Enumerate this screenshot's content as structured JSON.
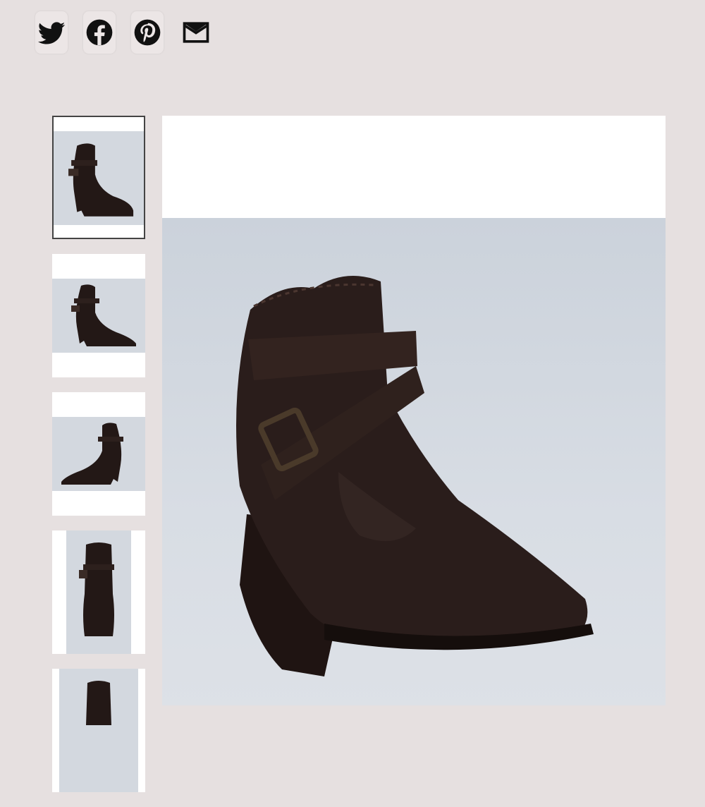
{
  "share": {
    "items": [
      {
        "name": "twitter",
        "icon": "twitter-icon"
      },
      {
        "name": "facebook",
        "icon": "facebook-icon"
      },
      {
        "name": "pinterest",
        "icon": "pinterest-icon"
      },
      {
        "name": "email",
        "icon": "mail-icon"
      }
    ]
  },
  "gallery": {
    "thumbnails": [
      {
        "view": "side-left",
        "active": true
      },
      {
        "view": "side-left-2",
        "active": false
      },
      {
        "view": "side-right",
        "active": false
      },
      {
        "view": "front",
        "active": false
      },
      {
        "view": "top-partial",
        "active": false
      }
    ],
    "main_image": {
      "view": "three-quarter-front"
    }
  },
  "colors": {
    "page_background": "#e6e0e0",
    "boot": "#2a1d1b",
    "photo_background": "#cfd6de"
  }
}
